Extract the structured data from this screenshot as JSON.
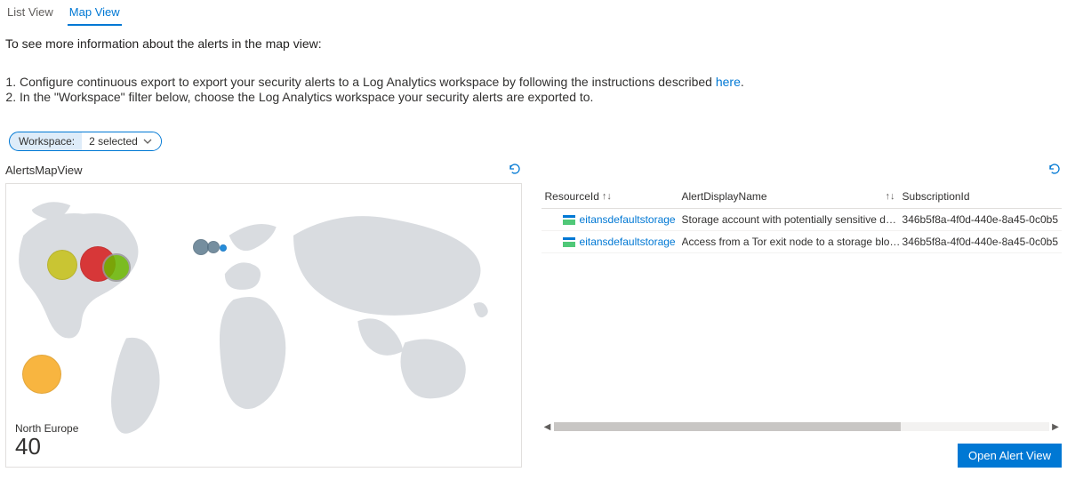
{
  "tabs": {
    "list": "List View",
    "map": "Map View"
  },
  "intro": "To see more information about the alerts in the map view:",
  "instructions": {
    "item1_prefix": "Configure continuous export to export your security alerts to a Log Analytics workspace by following the instructions described ",
    "item1_link": "here",
    "item1_suffix": ".",
    "item2": "In the \"Workspace\" filter below, choose the Log Analytics workspace your security alerts are exported to."
  },
  "filter": {
    "label": "Workspace:",
    "value": "2 selected"
  },
  "left_panel": {
    "title": "AlertsMapView",
    "region_name": "North Europe",
    "region_count": "40"
  },
  "right_panel": {
    "headers": {
      "resource": "ResourceId",
      "alert": "AlertDisplayName",
      "sub": "SubscriptionId"
    },
    "rows": [
      {
        "resource": "eitansdefaultstorage",
        "alert": "Storage account with potentially sensitive data has ...",
        "sub": "346b5f8a-4f0d-440e-8a45-0c0b5"
      },
      {
        "resource": "eitansdefaultstorage",
        "alert": "Access from a Tor exit node to a storage blob conta...",
        "sub": "346b5f8a-4f0d-440e-8a45-0c0b5"
      }
    ],
    "cta": "Open Alert View"
  }
}
